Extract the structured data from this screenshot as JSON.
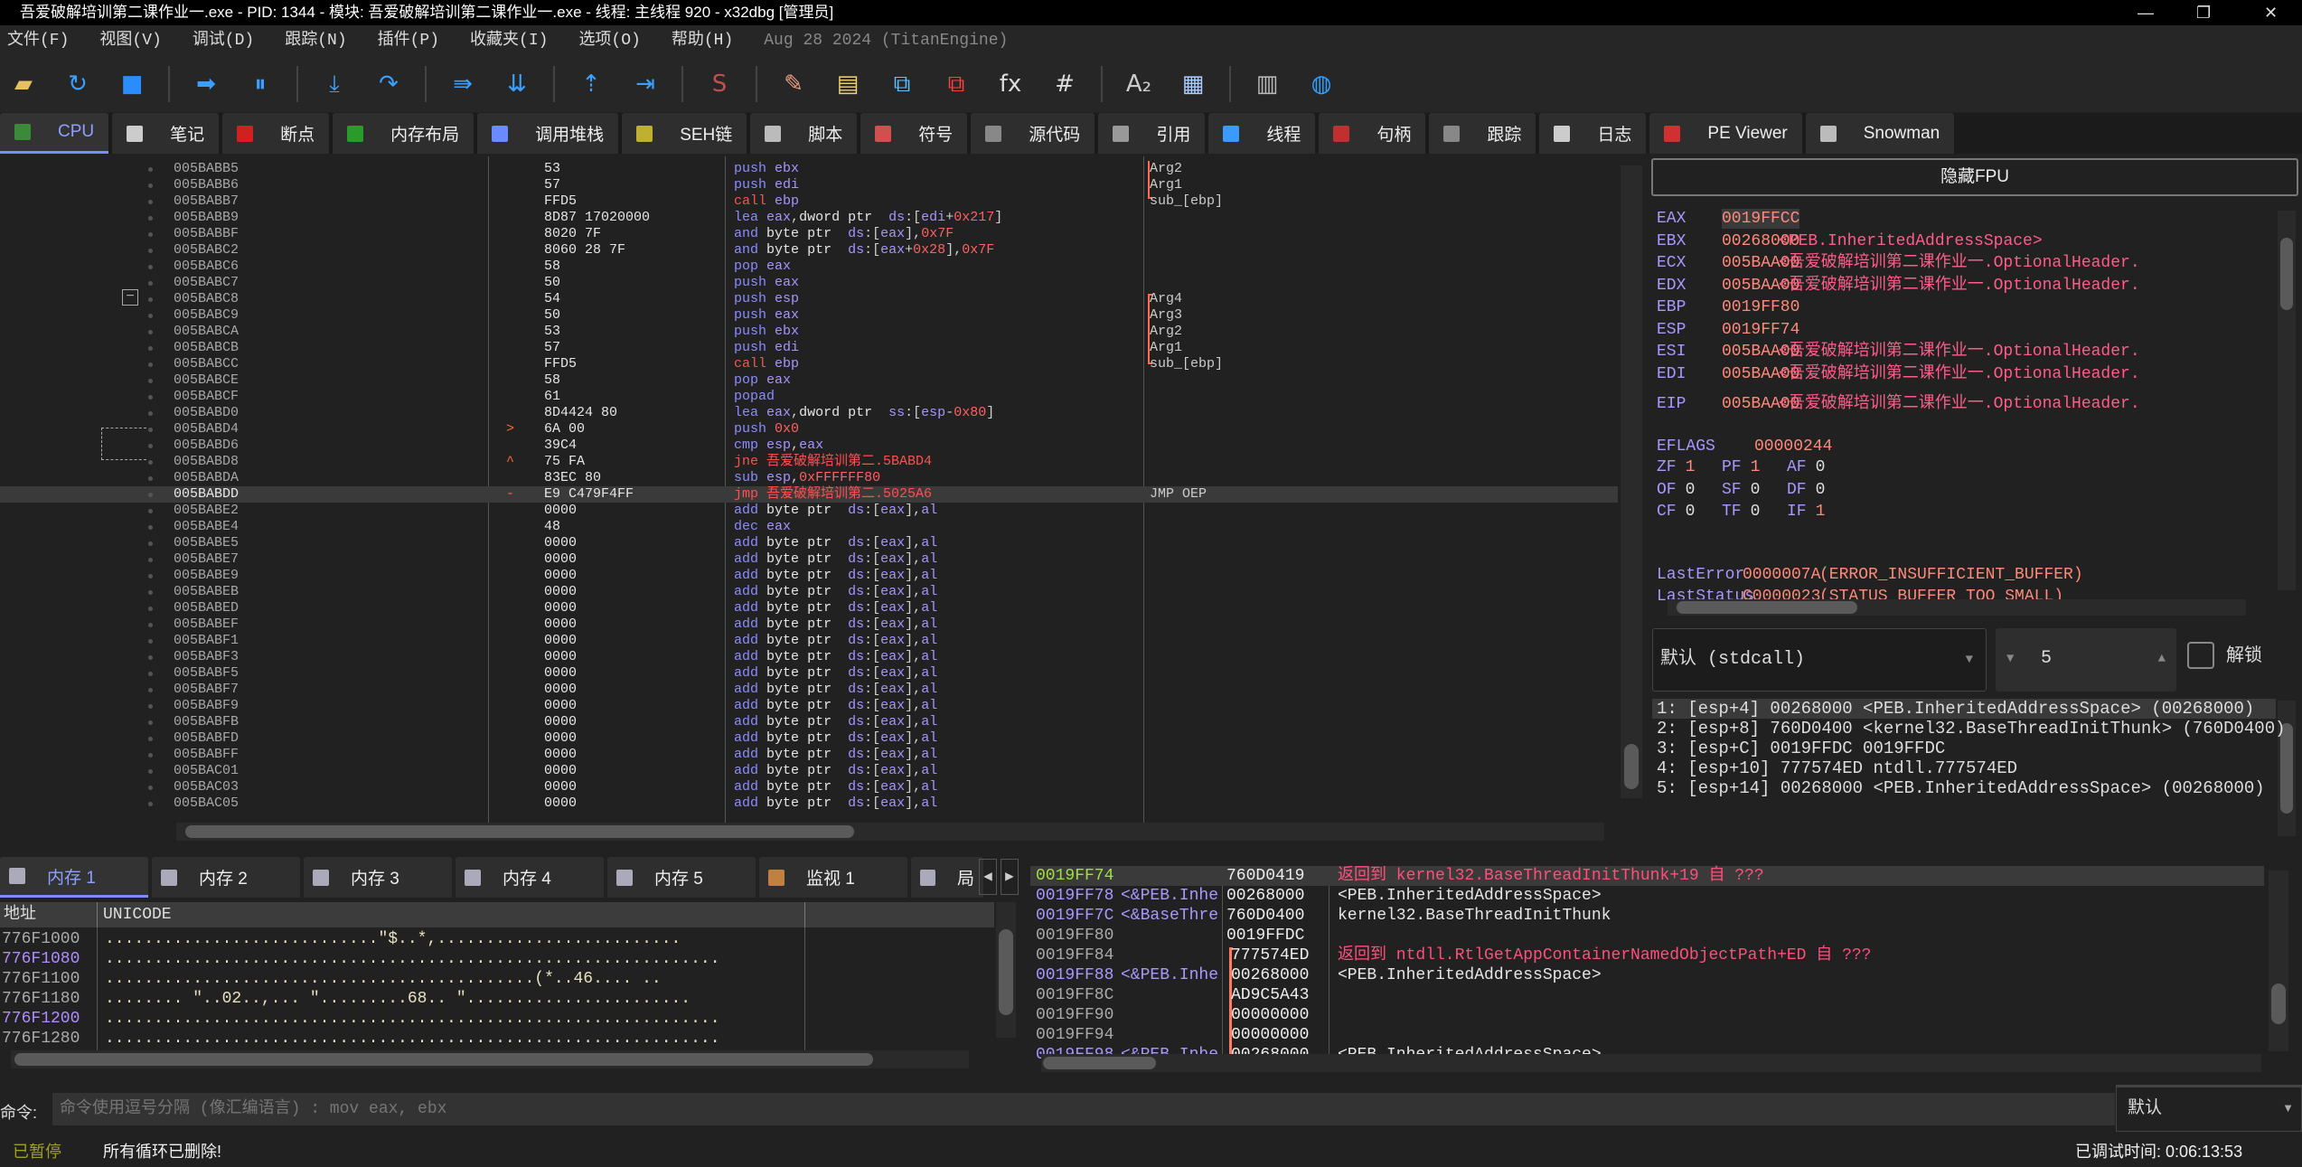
{
  "window": {
    "title": "吾爱破解培训第二课作业一.exe - PID: 1344 - 模块: 吾爱破解培训第二课作业一.exe - 线程: 主线程 920 - x32dbg [管理员]",
    "minimize": "—",
    "maximize": "❐",
    "close": "✕"
  },
  "menu": {
    "items": [
      "文件(F)",
      "视图(V)",
      "调试(D)",
      "跟踪(N)",
      "插件(P)",
      "收藏夹(I)",
      "选项(O)",
      "帮助(H)"
    ],
    "version": "Aug 28 2024 (TitanEngine)"
  },
  "toolbar": [
    {
      "name": "open-icon",
      "g": "▰",
      "c": "#e8c060"
    },
    {
      "name": "restart-icon",
      "g": "↻",
      "c": "#3aa0ff"
    },
    {
      "name": "stop-icon",
      "g": "■",
      "c": "#2a8cff"
    },
    {
      "sep": true
    },
    {
      "name": "run-icon",
      "g": "➡",
      "c": "#3aa0ff"
    },
    {
      "name": "pause-icon",
      "g": "⏸",
      "c": "#3aa0ff"
    },
    {
      "sep": true
    },
    {
      "name": "step-into-icon",
      "g": "⤓",
      "c": "#3aa0ff"
    },
    {
      "name": "step-over-icon",
      "g": "↷",
      "c": "#3aa0ff"
    },
    {
      "sep": true
    },
    {
      "name": "trace-into-icon",
      "g": "⇛",
      "c": "#3aa0ff"
    },
    {
      "name": "trace-over-icon",
      "g": "⇊",
      "c": "#3aa0ff"
    },
    {
      "sep": true
    },
    {
      "name": "execute-till-return-icon",
      "g": "⇡",
      "c": "#3aa0ff"
    },
    {
      "name": "run-to-user-code-icon",
      "g": "⇥",
      "c": "#3aa0ff"
    },
    {
      "sep": true
    },
    {
      "name": "scylla-icon",
      "g": "S",
      "c": "#c05050"
    },
    {
      "sep": true
    },
    {
      "name": "patch-icon",
      "g": "✎",
      "c": "#f0a080"
    },
    {
      "name": "comments-icon",
      "g": "▤",
      "c": "#f0d070"
    },
    {
      "name": "labels-icon",
      "g": "⧉",
      "c": "#60c0ff"
    },
    {
      "name": "bookmarks-icon",
      "g": "⧉",
      "c": "#ff4040"
    },
    {
      "name": "functions-icon",
      "g": "fx",
      "c": "#ddd"
    },
    {
      "name": "hash-icon",
      "g": "#",
      "c": "#ddd"
    },
    {
      "sep": true
    },
    {
      "name": "strings-icon",
      "g": "A₂",
      "c": "#ccc"
    },
    {
      "name": "calculator-icon",
      "g": "▦",
      "c": "#aaccff"
    },
    {
      "sep": true
    },
    {
      "name": "memory-icon",
      "g": "▥",
      "c": "#bbb"
    },
    {
      "name": "globe-icon",
      "g": "◍",
      "c": "#30a0ff"
    }
  ],
  "tabs": [
    {
      "label": "CPU",
      "color": "#3a8a3a",
      "active": true
    },
    {
      "label": "笔记",
      "color": "#ccc"
    },
    {
      "label": "断点",
      "color": "#d02020"
    },
    {
      "label": "内存布局",
      "color": "#2a9a2a"
    },
    {
      "label": "调用堆栈",
      "color": "#6a8aff"
    },
    {
      "label": "SEH链",
      "color": "#c0b030"
    },
    {
      "label": "脚本",
      "color": "#bbb"
    },
    {
      "label": "符号",
      "color": "#d05050"
    },
    {
      "label": "源代码",
      "color": "#888"
    },
    {
      "label": "引用",
      "color": "#999"
    },
    {
      "label": "线程",
      "color": "#3a9aff"
    },
    {
      "label": "句柄",
      "color": "#c03030"
    },
    {
      "label": "跟踪",
      "color": "#888"
    },
    {
      "label": "日志",
      "color": "#ccc"
    },
    {
      "label": "PE Viewer",
      "color": "#d03030"
    },
    {
      "label": "Snowman",
      "color": "#bbb"
    }
  ],
  "disasm": [
    [
      "005BABB5",
      "",
      "53",
      "push ebx",
      "Arg2"
    ],
    [
      "005BABB6",
      "",
      "57",
      "push edi",
      "Arg1"
    ],
    [
      "005BABB7",
      "",
      "FFD5",
      "call ebp",
      "sub_[ebp]"
    ],
    [
      "005BABB9",
      "",
      "8D87 17020000",
      "lea eax,dword ptr  ds:[edi+0x217]",
      ""
    ],
    [
      "005BABBF",
      "",
      "8020 7F",
      "and byte ptr  ds:[eax],0x7F",
      ""
    ],
    [
      "005BABC2",
      "",
      "8060 28 7F",
      "and byte ptr  ds:[eax+0x28],0x7F",
      ""
    ],
    [
      "005BABC6",
      "",
      "58",
      "pop eax",
      ""
    ],
    [
      "005BABC7",
      "",
      "50",
      "push eax",
      ""
    ],
    [
      "005BABC8",
      "",
      "54",
      "push esp",
      "Arg4"
    ],
    [
      "005BABC9",
      "",
      "50",
      "push eax",
      "Arg3"
    ],
    [
      "005BABCA",
      "",
      "53",
      "push ebx",
      "Arg2"
    ],
    [
      "005BABCB",
      "",
      "57",
      "push edi",
      "Arg1"
    ],
    [
      "005BABCC",
      "",
      "FFD5",
      "call ebp",
      "sub_[ebp]"
    ],
    [
      "005BABCE",
      "",
      "58",
      "pop eax",
      ""
    ],
    [
      "005BABCF",
      "",
      "61",
      "popad",
      ""
    ],
    [
      "005BABD0",
      "",
      "8D4424 80",
      "lea eax,dword ptr  ss:[esp-0x80]",
      ""
    ],
    [
      "005BABD4",
      ">",
      "6A 00",
      "push 0x0",
      ""
    ],
    [
      "005BABD6",
      "",
      "39C4",
      "cmp esp,eax",
      ""
    ],
    [
      "005BABD8",
      "^",
      "75 FA",
      "jne 吾爱破解培训第二.5BABD4",
      ""
    ],
    [
      "005BABDA",
      "",
      "83EC 80",
      "sub esp,0xFFFFFF80",
      ""
    ],
    [
      "005BABDD",
      "-",
      "E9 C479F4FF",
      "jmp 吾爱破解培训第二.5025A6",
      "JMP OEP"
    ],
    [
      "005BABE2",
      "",
      "0000",
      "add byte ptr  ds:[eax],al",
      ""
    ],
    [
      "005BABE4",
      "",
      "48",
      "dec eax",
      ""
    ],
    [
      "005BABE5",
      "",
      "0000",
      "add byte ptr  ds:[eax],al",
      ""
    ],
    [
      "005BABE7",
      "",
      "0000",
      "add byte ptr  ds:[eax],al",
      ""
    ],
    [
      "005BABE9",
      "",
      "0000",
      "add byte ptr  ds:[eax],al",
      ""
    ],
    [
      "005BABEB",
      "",
      "0000",
      "add byte ptr  ds:[eax],al",
      ""
    ],
    [
      "005BABED",
      "",
      "0000",
      "add byte ptr  ds:[eax],al",
      ""
    ],
    [
      "005BABEF",
      "",
      "0000",
      "add byte ptr  ds:[eax],al",
      ""
    ],
    [
      "005BABF1",
      "",
      "0000",
      "add byte ptr  ds:[eax],al",
      ""
    ],
    [
      "005BABF3",
      "",
      "0000",
      "add byte ptr  ds:[eax],al",
      ""
    ],
    [
      "005BABF5",
      "",
      "0000",
      "add byte ptr  ds:[eax],al",
      ""
    ],
    [
      "005BABF7",
      "",
      "0000",
      "add byte ptr  ds:[eax],al",
      ""
    ],
    [
      "005BABF9",
      "",
      "0000",
      "add byte ptr  ds:[eax],al",
      ""
    ],
    [
      "005BABFB",
      "",
      "0000",
      "add byte ptr  ds:[eax],al",
      ""
    ],
    [
      "005BABFD",
      "",
      "0000",
      "add byte ptr  ds:[eax],al",
      ""
    ],
    [
      "005BABFF",
      "",
      "0000",
      "add byte ptr  ds:[eax],al",
      ""
    ],
    [
      "005BAC01",
      "",
      "0000",
      "add byte ptr  ds:[eax],al",
      ""
    ],
    [
      "005BAC03",
      "",
      "0000",
      "add byte ptr  ds:[eax],al",
      ""
    ],
    [
      "005BAC05",
      "",
      "0000",
      "add byte ptr  ds:[eax],al",
      ""
    ]
  ],
  "disasm_current": "005BABDD",
  "registers": {
    "hide_fpu": "隐藏FPU",
    "gp": [
      [
        "EAX",
        "0019FFCC",
        ""
      ],
      [
        "EBX",
        "00268000",
        "<PEB.InheritedAddressSpace>"
      ],
      [
        "ECX",
        "005BAA00",
        "<吾爱破解培训第二课作业一.OptionalHeader."
      ],
      [
        "EDX",
        "005BAA00",
        "<吾爱破解培训第二课作业一.OptionalHeader."
      ],
      [
        "EBP",
        "0019FF80",
        ""
      ],
      [
        "ESP",
        "0019FF74",
        ""
      ],
      [
        "ESI",
        "005BAA00",
        "<吾爱破解培训第二课作业一.OptionalHeader."
      ],
      [
        "EDI",
        "005BAA00",
        "<吾爱破解培训第二课作业一.OptionalHeader."
      ]
    ],
    "eip": [
      "EIP",
      "005BAA00",
      "<吾爱破解培训第二课作业一.OptionalHeader."
    ],
    "eflags": [
      "EFLAGS",
      "00000244"
    ],
    "flags": [
      [
        [
          "ZF",
          "1"
        ],
        [
          "PF",
          "1"
        ],
        [
          "AF",
          "0"
        ]
      ],
      [
        [
          "OF",
          "0"
        ],
        [
          "SF",
          "0"
        ],
        [
          "DF",
          "0"
        ]
      ],
      [
        [
          "CF",
          "0"
        ],
        [
          "TF",
          "0"
        ],
        [
          "IF",
          "1"
        ]
      ]
    ],
    "lasterror": [
      "LastError",
      "0000007A",
      "(ERROR_INSUFFICIENT_BUFFER)"
    ],
    "laststatus": [
      "LastStatus",
      "C0000023",
      "(STATUS_BUFFER_TOO_SMALL)"
    ]
  },
  "callargs": {
    "convention": "默认 (stdcall)",
    "count": "5",
    "unlock_label": "解锁",
    "unlocked": false,
    "items": [
      "1: [esp+4] 00268000 <PEB.InheritedAddressSpace> (00268000)",
      "2: [esp+8] 760D0400 <kernel32.BaseThreadInitThunk> (760D0400)",
      "3: [esp+C] 0019FFDC 0019FFDC",
      "4: [esp+10] 777574ED ntdll.777574ED",
      "5: [esp+14] 00268000 <PEB.InheritedAddressSpace> (00268000)"
    ]
  },
  "bottom_tabs": [
    {
      "label": "内存 1",
      "active": true
    },
    {
      "label": "内存 2"
    },
    {
      "label": "内存 3"
    },
    {
      "label": "内存 4"
    },
    {
      "label": "内存 5"
    },
    {
      "label": "监视 1"
    },
    {
      "label": "局"
    }
  ],
  "dump": {
    "col_address": "地址",
    "col_unicode": "UNICODE",
    "rows": [
      [
        "776F1000",
        "............................\"$..*,........................."
      ],
      [
        "776F1080",
        "..............................................................."
      ],
      [
        "776F1100",
        "............................................(*..46.... .."
      ],
      [
        "776F1180",
        "........ \"..02..,... \".........68.. \"......................."
      ],
      [
        "776F1200",
        "..............................................................."
      ],
      [
        "776F1280",
        "..............................................................."
      ]
    ]
  },
  "stack": [
    [
      "0019FF74",
      "",
      "760D0419",
      "返回到 kernel32.BaseThreadInitThunk+19 自 ???"
    ],
    [
      "0019FF78",
      "<&PEB.Inhe",
      "00268000",
      "<PEB.InheritedAddressSpace>"
    ],
    [
      "0019FF7C",
      "<&BaseThre",
      "760D0400",
      "kernel32.BaseThreadInitThunk"
    ],
    [
      "0019FF80",
      "",
      "0019FFDC",
      ""
    ],
    [
      "0019FF84",
      "",
      "777574ED",
      "返回到 ntdll.RtlGetAppContainerNamedObjectPath+ED 自 ???"
    ],
    [
      "0019FF88",
      "<&PEB.Inhe",
      "00268000",
      "<PEB.InheritedAddressSpace>"
    ],
    [
      "0019FF8C",
      "",
      "AD9C5A43",
      ""
    ],
    [
      "0019FF90",
      "",
      "00000000",
      ""
    ],
    [
      "0019FF94",
      "",
      "00000000",
      ""
    ],
    [
      "0019FF98",
      "<&PEB.Inhe",
      "00268000",
      "<PEB.InheritedAddressSpace>"
    ]
  ],
  "command": {
    "label": "命令:",
    "placeholder": "命令使用逗号分隔 (像汇编语言) : mov eax, ebx",
    "mode": "默认"
  },
  "status": {
    "state": "已暂停",
    "message": "所有循环已删除!",
    "time": "已调试时间:  0:06:13:53"
  }
}
